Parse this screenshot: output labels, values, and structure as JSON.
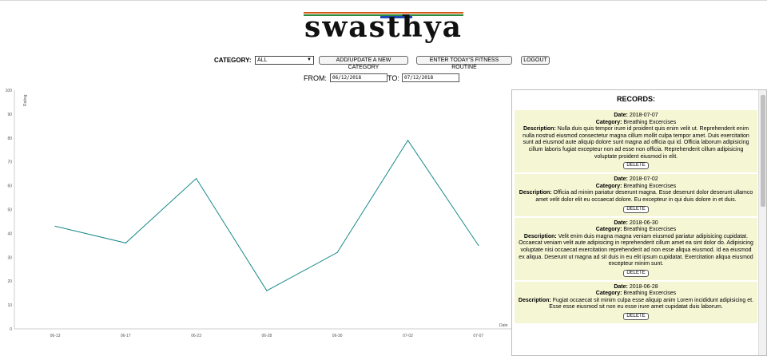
{
  "app": {
    "logo_text": "swasthya"
  },
  "controls": {
    "category_label": "CATEGORY:",
    "category_selected": "ALL",
    "add_category_label": "ADD/UPDATE A NEW CATEGORY",
    "fitness_routine_label": "ENTER TODAY'S FITNESS ROUTINE",
    "logout_label": "LOGOUT"
  },
  "dates": {
    "from_label": "FROM:",
    "from_value": "06/12/2018",
    "to_label": "TO:",
    "to_value": "07/12/2018"
  },
  "chart_data": {
    "type": "line",
    "categories": [
      "06-13",
      "06-17",
      "06-23",
      "06-28",
      "06-30",
      "07-02",
      "07-07"
    ],
    "values": [
      43,
      36,
      63,
      16,
      32,
      79,
      35
    ],
    "ylabel": "Rating",
    "xlabel": "Date",
    "ylim": [
      0,
      100
    ],
    "yticks": [
      "0",
      "10",
      "20",
      "30",
      "40",
      "50",
      "60",
      "70",
      "80",
      "90",
      "100"
    ],
    "line_color": "#1a8a8a",
    "grid": false
  },
  "records": {
    "title": "RECORDS:",
    "labels": {
      "date": "Date:",
      "category": "Category:",
      "description": "Description:",
      "delete": "DELETE"
    },
    "items": [
      {
        "date": "2018-07-07",
        "category": "Breathing Excercises",
        "description": "Nulla duis quis tempor irure id proident quis enim velit ut. Reprehenderit enim nulla nostrud eiusmod consectetur magna cillum mollit culpa tempor amet. Duis exercitation sunt ad eiusmod aute aliquip dolore sunt magna ad officia qui id. Officia laborum adipisicing cillum laboris fugiat excepteur non ad esse non officia. Reprehenderit cillum adipisicing voluptate proident eiusmod in elit."
      },
      {
        "date": "2018-07-02",
        "category": "Breathing Excercises",
        "description": "Officia ad minim pariatur deserunt magna. Esse deserunt dolor deserunt ullamco amet velit dolor elit eu occaecat dolore. Eu excepteur in qui duis dolore in et duis."
      },
      {
        "date": "2018-06-30",
        "category": "Breathing Excercises",
        "description": "Velit enim duis magna magna veniam eiusmod pariatur adipisicing cupidatat. Occaecat veniam velit aute adipisicing in reprehenderit cillum amet ea sint dolor do. Adipisicing voluptate nisi occaecat exercitation reprehenderit ad non esse aliqua eiusmod. Id ea eiusmod ex aliqua. Deserunt ut magna ad sit duis in eu elit ipsum cupidatat. Exercitation aliqua eiusmod excepteur minim sunt."
      },
      {
        "date": "2018-06-28",
        "category": "Breathing Excercises",
        "description": "Fugiat occaecat sit minim culpa esse aliquip anim Lorem incididunt adipisicing et. Esse esse eiusmod sit non eu esse irure amet cupidatat duis laborum."
      }
    ]
  }
}
